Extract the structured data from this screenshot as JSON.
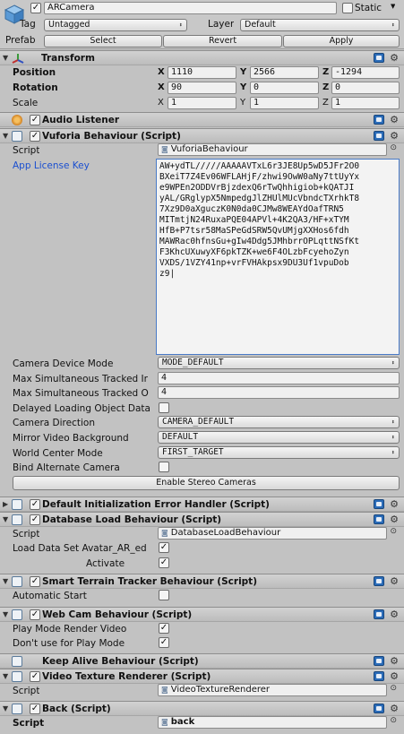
{
  "top": {
    "name": "ARCamera",
    "static_label": "Static",
    "tag_label": "Tag",
    "tag_value": "Untagged",
    "layer_label": "Layer",
    "layer_value": "Default",
    "prefab_label": "Prefab",
    "select_label": "Select",
    "revert_label": "Revert",
    "apply_label": "Apply"
  },
  "transform": {
    "title": "Transform",
    "position_label": "Position",
    "rotation_label": "Rotation",
    "scale_label": "Scale",
    "axis_x": "X",
    "axis_y": "Y",
    "axis_z": "Z",
    "position": {
      "x": "1110",
      "y": "2566",
      "z": "-1294"
    },
    "rotation": {
      "x": "90",
      "y": "0",
      "z": "0"
    },
    "scale": {
      "x": "1",
      "y": "1",
      "z": "1"
    }
  },
  "audio_listener": {
    "title": "Audio Listener"
  },
  "vuforia": {
    "title": "Vuforia Behaviour (Script)",
    "script_label": "Script",
    "script_value": "VuforiaBehaviour",
    "license_label": "App License Key",
    "license_lines": [
      "AW+ydTL/////AAAAAVTxL6r3JE8Up5wD5JFr2O0",
      "BXeiT7Z4Ev06WFLAHjF/zhwi9OwW0aNy7ttUyYx",
      "e9WPEn2ODDVrBjzdexQ6rTwQhhigiob+kQATJI",
      "yAL/GRglypX5NmpedgJlZHUlMUcVbndcTXrhkT8",
      "7Xz9D0aXguczK0N0da0CJMw8WEAYdOafTRN5",
      "MITmtjN24RuxaPQE04APVl+4K2QA3/HF+xTYM",
      "HfB+P7tsr58MaSPeGdSRW5QvUMjgXXHos6fdh",
      "MAWRac0hfnsGu+gIw4Ddg5JMhbrrOPLqttNSfKt",
      "F3KhcUXuwyXF6pkTZK+we6F4OLzbFcyehoZyn",
      "VXDS/1VZY41np+vrFVHAkpsx9DU3Uf1vpuDob",
      "z9"
    ],
    "camera_device_mode_label": "Camera Device Mode",
    "camera_device_mode_value": "MODE_DEFAULT",
    "max_tracked_images_label": "Max Simultaneous Tracked Ir",
    "max_tracked_images_value": "4",
    "max_tracked_objects_label": "Max Simultaneous Tracked O",
    "max_tracked_objects_value": "4",
    "delayed_loading_label": "Delayed Loading Object Data",
    "camera_direction_label": "Camera Direction",
    "camera_direction_value": "CAMERA_DEFAULT",
    "mirror_video_label": "Mirror Video Background",
    "mirror_video_value": "DEFAULT",
    "world_center_label": "World Center Mode",
    "world_center_value": "FIRST_TARGET",
    "bind_alt_label": "Bind Alternate Camera",
    "stereo_button": "Enable Stereo Cameras"
  },
  "default_init": {
    "title": "Default Initialization Error Handler (Script)"
  },
  "database_load": {
    "title": "Database Load Behaviour (Script)",
    "script_label": "Script",
    "script_value": "DatabaseLoadBehaviour",
    "load_label": "Load Data Set Avatar_AR_ed",
    "activate_label": "Activate"
  },
  "smart_terrain": {
    "title": "Smart Terrain Tracker Behaviour (Script)",
    "auto_start_label": "Automatic Start"
  },
  "webcam": {
    "title": "Web Cam Behaviour (Script)",
    "play_mode_label": "Play Mode Render Video",
    "dont_use_label": "Don't use for Play Mode"
  },
  "keep_alive": {
    "title": "Keep Alive Behaviour (Script)"
  },
  "video_texture": {
    "title": "Video Texture Renderer (Script)",
    "script_label": "Script",
    "script_value": "VideoTextureRenderer"
  },
  "back": {
    "title": "Back (Script)",
    "script_label": "Script",
    "script_value": "back"
  },
  "colors": {
    "panel_bg": "#c2c2c2",
    "header_bg": "#c6c6c6",
    "link_blue": "#1a4fd0",
    "focus_border": "#4a7bc7"
  },
  "icons": [
    "cube-icon",
    "transform-icon",
    "audio-listener-icon",
    "script-icon",
    "gear-icon",
    "help-book-icon",
    "foldout-arrow-icon"
  ]
}
